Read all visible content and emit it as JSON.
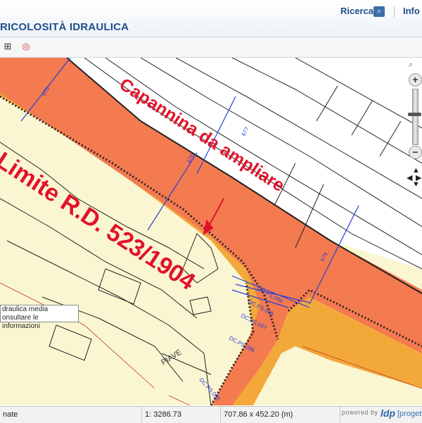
{
  "header": {
    "title": "RICOLOSITÀ IDRAULICA",
    "ricerca_label": "Ricerca",
    "info_label": "Info",
    "ricerca_icon": "search-icon"
  },
  "toolbar": {
    "tools": [
      "layers-edit-icon",
      "target-icon"
    ]
  },
  "map": {
    "annotations": {
      "capannina": "Capannina da ampliare",
      "limite": "Limite R.D. 523/1904"
    },
    "street": "PIAVE",
    "contour_labels": [
      "DC.PS.095",
      "DC.PS.096",
      "DC.PS.097",
      "DC.PS.098",
      "DC.PS.099"
    ],
    "section_labels": [
      "675",
      "676",
      "677",
      "678"
    ],
    "colors": {
      "background": "#fbf6d2",
      "river_band": "#f47a4f",
      "levee": "#f2a93a",
      "annotation_red": "#e0132a",
      "section_line": "#2a3fd8"
    }
  },
  "legend": {
    "line1": "draulica media",
    "line2": "onsultare le informazioni"
  },
  "status": {
    "left": "nate",
    "scale": "1: 3286.73",
    "extent": "707.86 x 452.20 (m)",
    "powered_by": "powered by",
    "brand": "ldp",
    "brand_suffix": "[progetti"
  }
}
